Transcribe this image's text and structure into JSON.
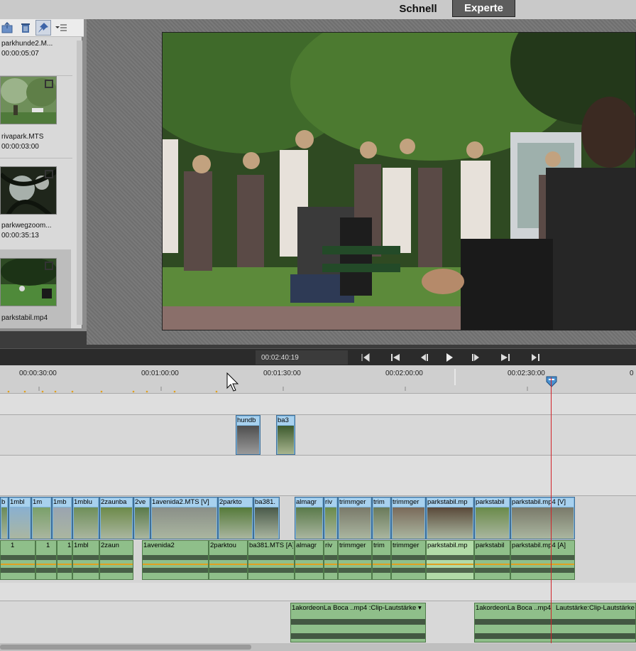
{
  "header": {
    "mode_quick": "Schnell",
    "mode_expert": "Experte"
  },
  "assets": {
    "items": [
      {
        "name": "parkhunde2.M...",
        "duration": "00:00:05:07"
      },
      {
        "name": "rivapark.MTS",
        "duration": "00:00:03:00"
      },
      {
        "name": "parkwegzoom...",
        "duration": "00:00:35:13"
      },
      {
        "name": "parkstabil.mp4",
        "duration": ""
      }
    ]
  },
  "transport": {
    "timecode": "00:02:40:19"
  },
  "ruler": {
    "labels": [
      "00:00:30:00",
      "00:01:00:00",
      "00:01:30:00",
      "00:02:00:00",
      "00:02:30:00",
      "0"
    ]
  },
  "timeline": {
    "video2_clips": [
      "hundb",
      "ba3"
    ],
    "video1_clips": [
      "b",
      "1mbl",
      "1m",
      "1mb",
      "1mblu",
      "2zaunba",
      "2ve",
      "1avenida2.MTS [V]",
      "2parkto",
      "ba381.",
      "almagr",
      "riv",
      "trimmger",
      "trim",
      "trimmger",
      "parkstabil.mp",
      "parkstabil",
      "parkstabil.mp4 [V]"
    ],
    "audio1_clips": [
      "1",
      "1",
      "1",
      "1mbl",
      "2zaun",
      "1avenida2",
      "2parktou",
      "ba381.MTS [A]",
      "almagr",
      "riv",
      "trimmger",
      "trim",
      "trimmger",
      "parkstabil.mp",
      "parkstabil",
      "parkstabil.mp4 [A]"
    ],
    "music_clips": [
      "1akordeonLa Boca ..mp4 :Clip-Lautstärke ▾",
      "1akordeonLa Boca ..mp4",
      "Lautstärke:Clip-Lautstärke ▾"
    ]
  }
}
